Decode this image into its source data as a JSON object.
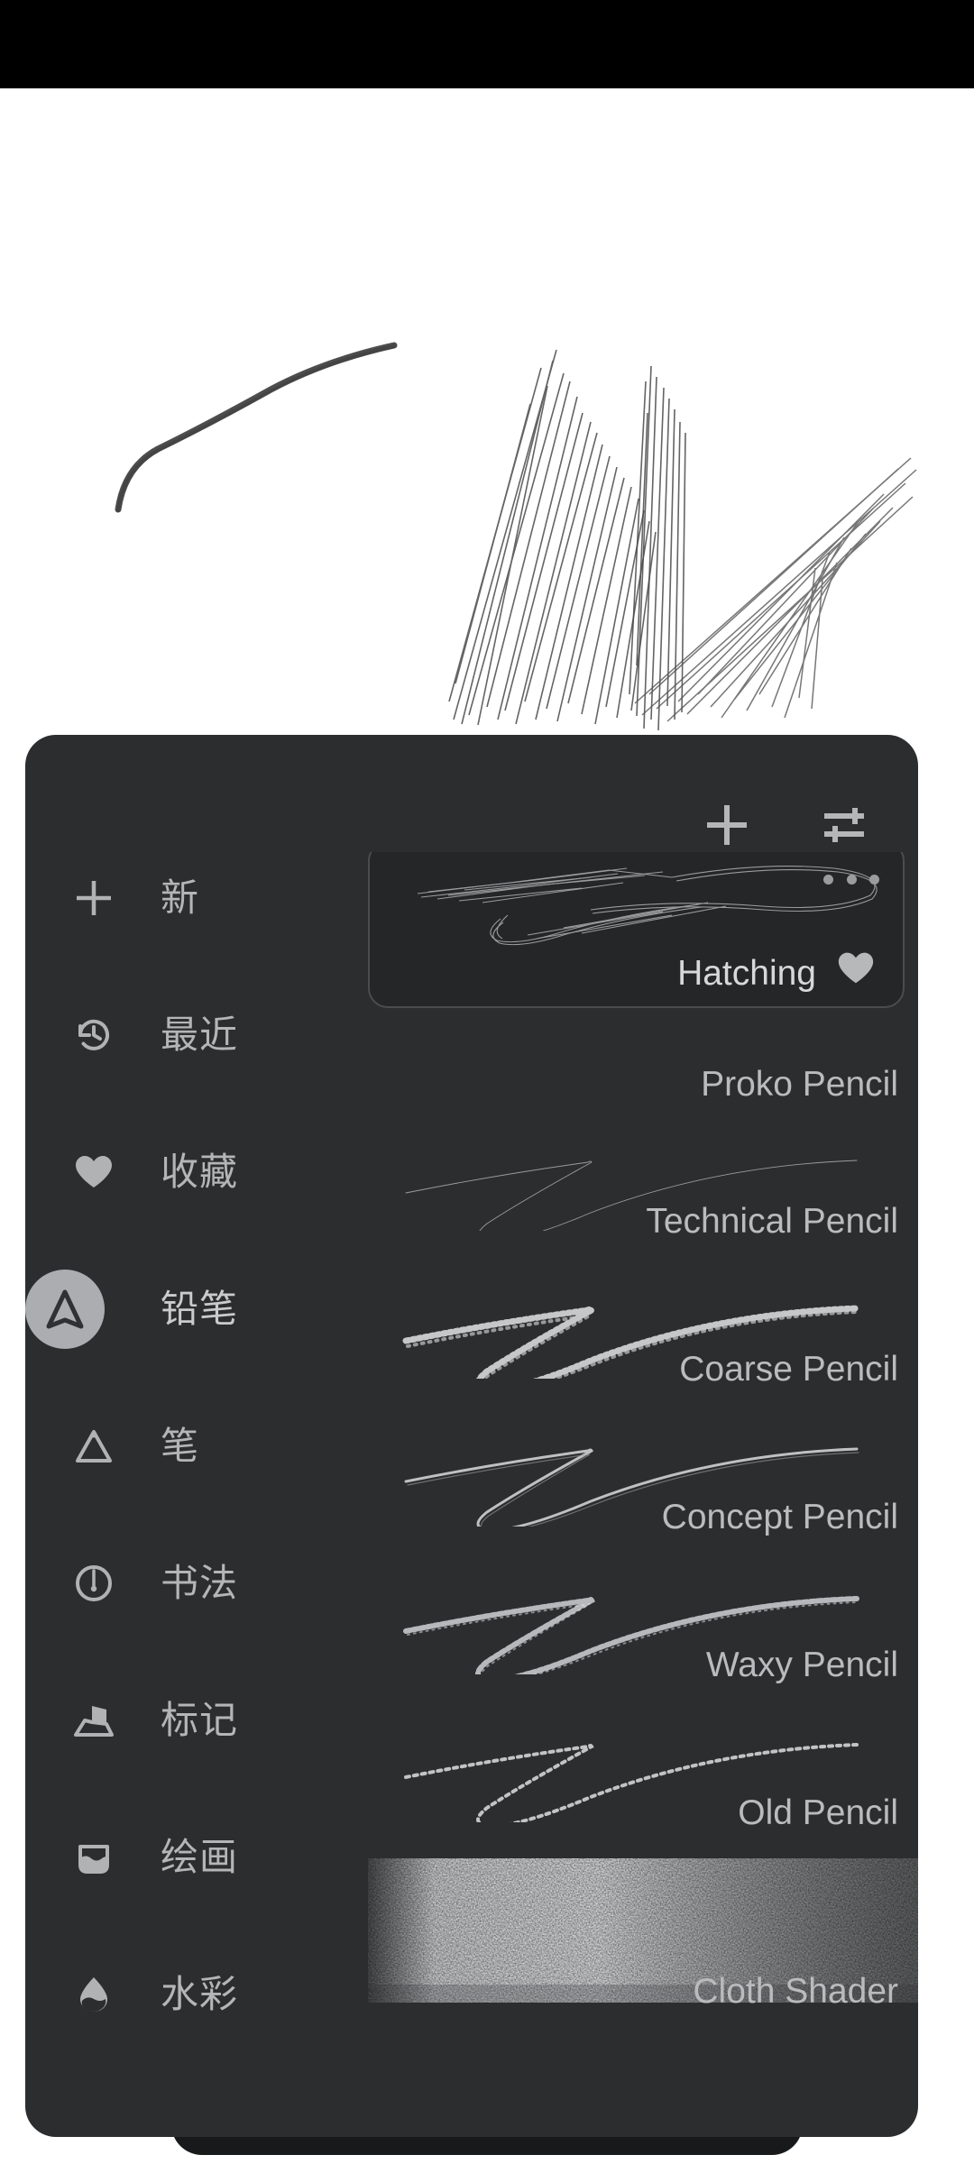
{
  "app": {
    "canvas_background": "#ffffff",
    "panel_background": "#2b2d2e",
    "accent": "#ABADB0"
  },
  "toolbar": {
    "home_label": "home-icon",
    "ruler_label": "compass-icon",
    "layers_label": "layers-icon",
    "more_label": "more-options-icon"
  },
  "panel_header": {
    "add_label": "add-brush-icon",
    "settings_label": "brush-settings-icon"
  },
  "sidebar": {
    "items": [
      {
        "label": "新",
        "icon": "plus-icon",
        "selected": false
      },
      {
        "label": "最近",
        "icon": "history-icon",
        "selected": false
      },
      {
        "label": "收藏",
        "icon": "heart-icon",
        "selected": false
      },
      {
        "label": "铅笔",
        "icon": "pencil-icon",
        "selected": true
      },
      {
        "label": "笔",
        "icon": "pen-icon",
        "selected": false
      },
      {
        "label": "书法",
        "icon": "calligraphy-icon",
        "selected": false
      },
      {
        "label": "标记",
        "icon": "marker-icon",
        "selected": false
      },
      {
        "label": "绘画",
        "icon": "paint-icon",
        "selected": false
      },
      {
        "label": "水彩",
        "icon": "watercolor-icon",
        "selected": false
      }
    ]
  },
  "brushes": {
    "selected_name": "Hatching",
    "selected_favorite": true,
    "items": [
      {
        "name": "Hatching",
        "selected": true
      },
      {
        "name": "Proko Pencil",
        "selected": false
      },
      {
        "name": "Technical Pencil",
        "selected": false
      },
      {
        "name": "Coarse Pencil",
        "selected": false
      },
      {
        "name": "Concept Pencil",
        "selected": false
      },
      {
        "name": "Waxy Pencil",
        "selected": false
      },
      {
        "name": "Old Pencil",
        "selected": false
      },
      {
        "name": "Cloth Shader",
        "selected": false
      }
    ]
  }
}
